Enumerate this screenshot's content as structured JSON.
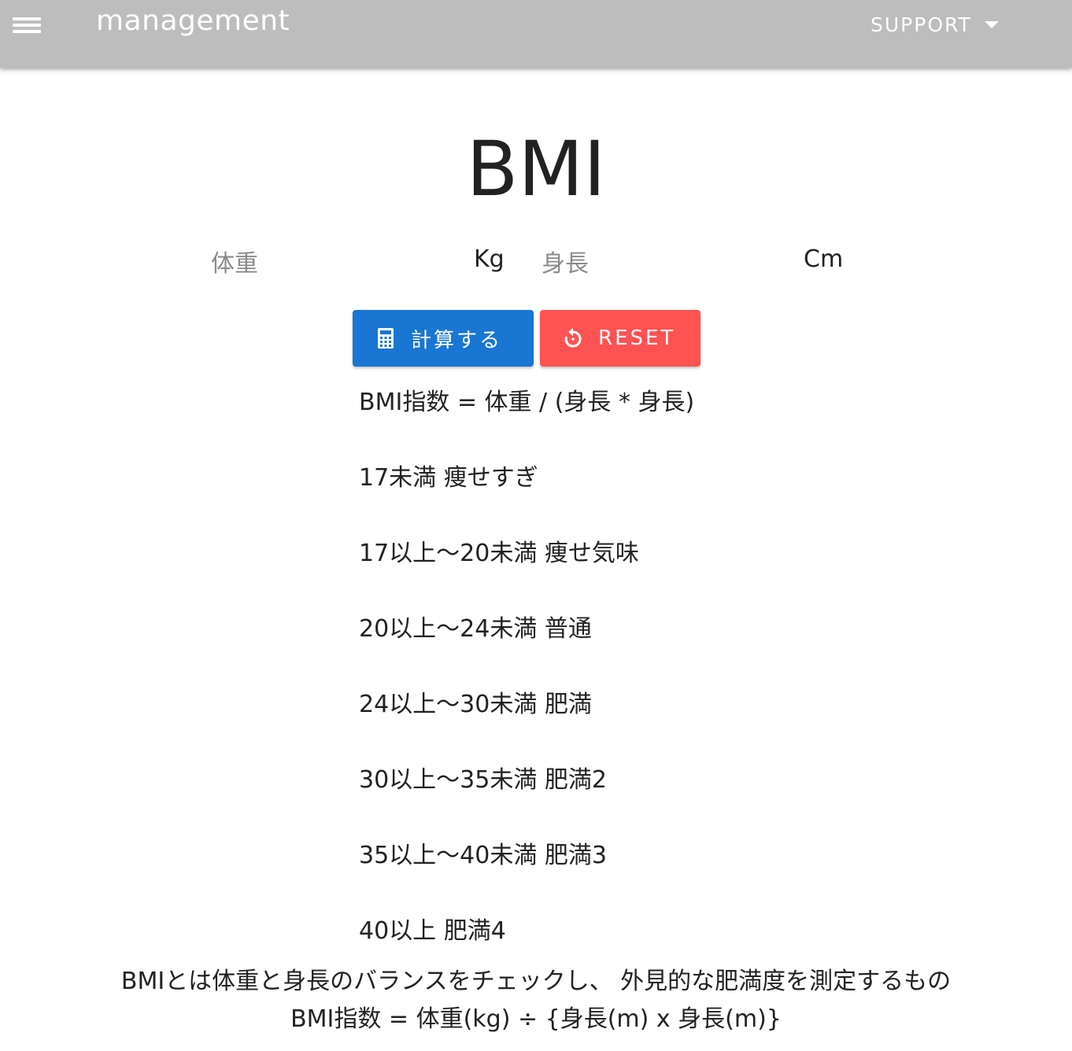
{
  "header": {
    "app_title": "management",
    "support_label": "SUPPORT"
  },
  "main": {
    "title": "BMI",
    "weight": {
      "label": "体重",
      "value": "",
      "unit": "Kg"
    },
    "height": {
      "label": "身長",
      "value": "",
      "unit": "Cm"
    },
    "calculate_label": "計算する",
    "reset_label": "RESET",
    "formula": "BMI指数 = 体重 / (身長 * 身長)",
    "categories": [
      "17未満 痩せすぎ",
      "17以上〜20未満 痩せ気味",
      "20以上〜24未満 普通",
      "24以上〜30未満 肥満",
      "30以上〜35未満 肥満2",
      "35以上〜40未満 肥満3",
      "40以上 肥満4"
    ],
    "description": "BMIとは体重と身長のバランスをチェックし、 外見的な肥満度を測定するもの",
    "description_formula": "BMI指数 = 体重(kg) ÷ {身長(m) x 身長(m)}"
  },
  "colors": {
    "app_bar": "#bdbdbd",
    "primary": "#1976d2",
    "error": "#ff5252"
  },
  "icons": {
    "menu": "hamburger-menu-icon",
    "dropdown": "chevron-down-icon",
    "calculate": "calculator-icon",
    "reset": "restore-icon"
  }
}
